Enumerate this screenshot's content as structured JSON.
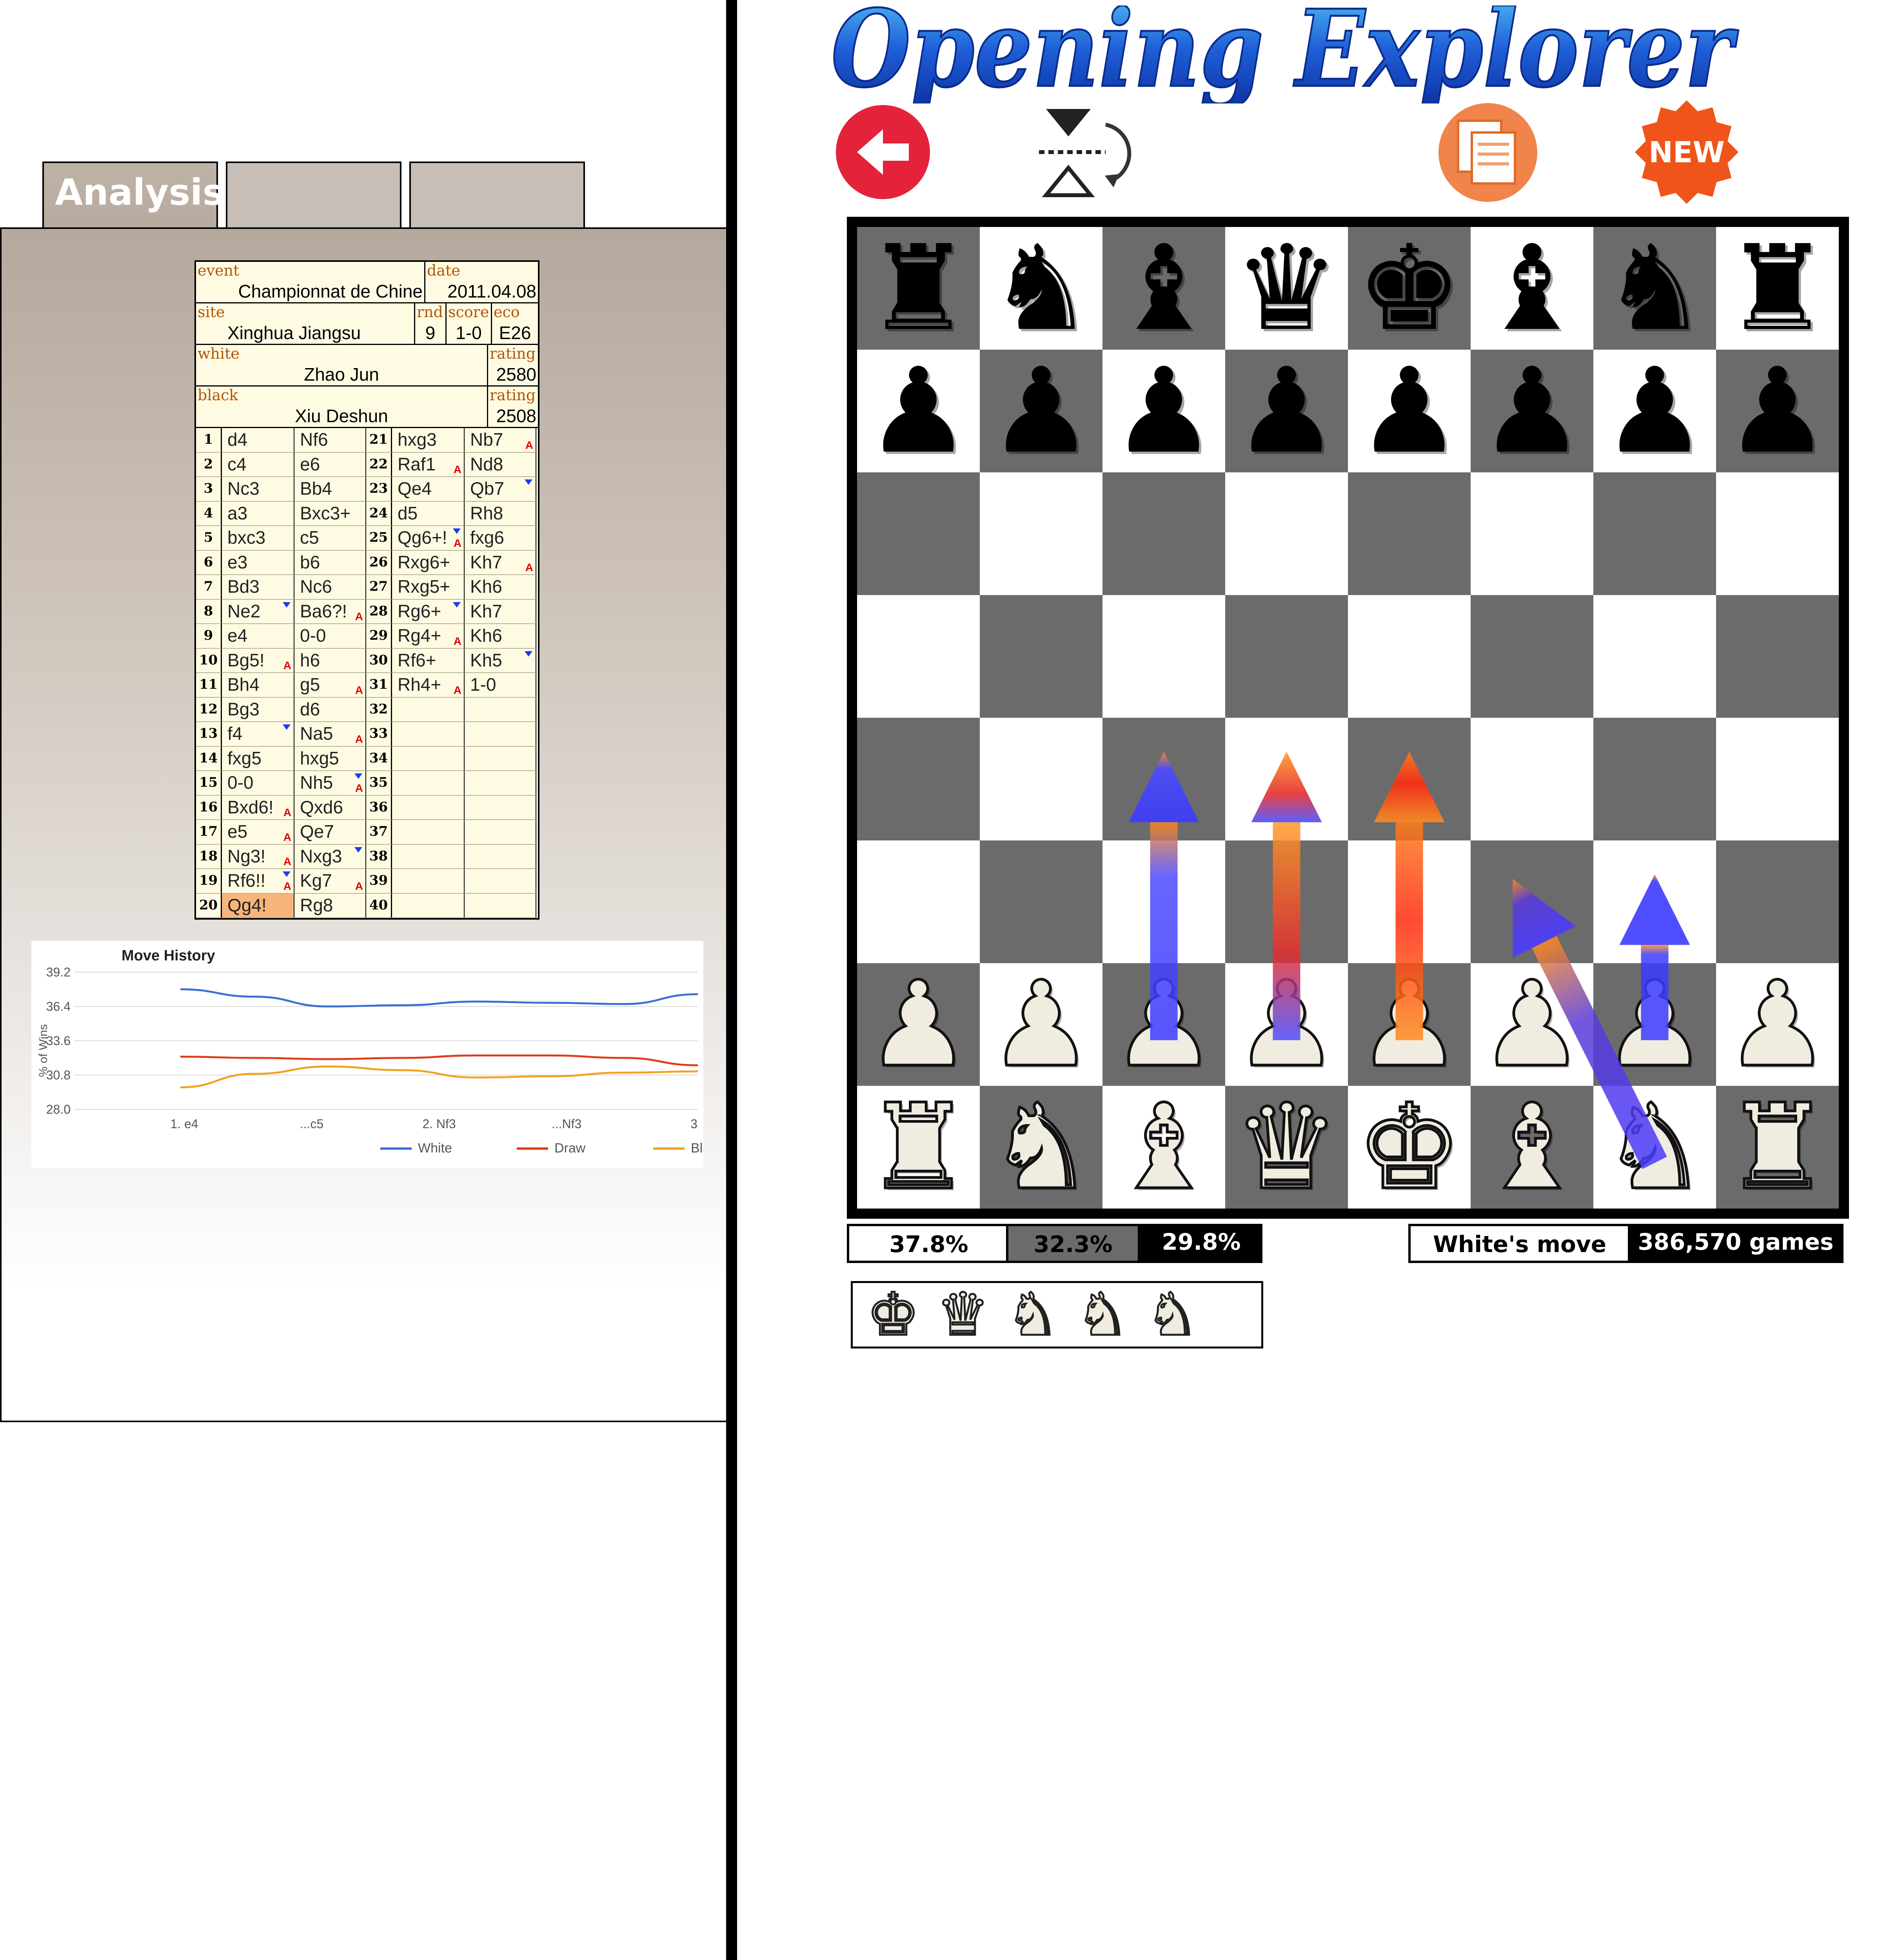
{
  "app": {
    "title": "Opening Explorer"
  },
  "tabs": [
    {
      "label": "Analysis"
    },
    {
      "label": ""
    },
    {
      "label": ""
    }
  ],
  "game_header": {
    "event_label": "event",
    "event": "Championnat de Chine",
    "date_label": "date",
    "date": "2011.04.08",
    "site_label": "site",
    "site": "Xinghua Jiangsu",
    "round_label": "rnd",
    "round": "9",
    "score_label": "score",
    "score": "1-0",
    "eco_label": "eco",
    "eco": "E26",
    "white_label": "white",
    "white": "Zhao Jun",
    "white_rating_label": "rating",
    "white_rating": "2580",
    "black_label": "black",
    "black": "Xiu Deshun",
    "black_rating_label": "rating",
    "black_rating": "2508"
  },
  "moves": [
    {
      "n": "1",
      "w": "d4",
      "b": "Nf6"
    },
    {
      "n": "2",
      "w": "c4",
      "b": "e6"
    },
    {
      "n": "3",
      "w": "Nc3",
      "b": "Bb4"
    },
    {
      "n": "4",
      "w": "a3",
      "b": "Bxc3+"
    },
    {
      "n": "5",
      "w": "bxc3",
      "b": "c5"
    },
    {
      "n": "6",
      "w": "e3",
      "b": "b6"
    },
    {
      "n": "7",
      "w": "Bd3",
      "b": "Nc6"
    },
    {
      "n": "8",
      "w": "Ne2",
      "b": "Ba6?!"
    },
    {
      "n": "9",
      "w": "e4",
      "b": "0-0"
    },
    {
      "n": "10",
      "w": "Bg5!",
      "b": "h6"
    },
    {
      "n": "11",
      "w": "Bh4",
      "b": "g5"
    },
    {
      "n": "12",
      "w": "Bg3",
      "b": "d6"
    },
    {
      "n": "13",
      "w": "f4",
      "b": "Na5"
    },
    {
      "n": "14",
      "w": "fxg5",
      "b": "hxg5"
    },
    {
      "n": "15",
      "w": "0-0",
      "b": "Nh5"
    },
    {
      "n": "16",
      "w": "Bxd6!",
      "b": "Qxd6"
    },
    {
      "n": "17",
      "w": "e5",
      "b": "Qe7"
    },
    {
      "n": "18",
      "w": "Ng3!",
      "b": "Nxg3"
    },
    {
      "n": "19",
      "w": "Rf6!!",
      "b": "Kg7"
    },
    {
      "n": "20",
      "w": "Qg4!",
      "b": "Rg8"
    },
    {
      "n": "21",
      "w": "hxg3",
      "b": "Nb7"
    },
    {
      "n": "22",
      "w": "Raf1",
      "b": "Nd8"
    },
    {
      "n": "23",
      "w": "Qe4",
      "b": "Qb7"
    },
    {
      "n": "24",
      "w": "d5",
      "b": "Rh8"
    },
    {
      "n": "25",
      "w": "Qg6+!",
      "b": "fxg6"
    },
    {
      "n": "26",
      "w": "Rxg6+",
      "b": "Kh7"
    },
    {
      "n": "27",
      "w": "Rxg5+",
      "b": "Kh6"
    },
    {
      "n": "28",
      "w": "Rg6+",
      "b": "Kh7"
    },
    {
      "n": "29",
      "w": "Rg4+",
      "b": "Kh6"
    },
    {
      "n": "30",
      "w": "Rf6+",
      "b": "Kh5"
    },
    {
      "n": "31",
      "w": "Rh4+",
      "b": "1-0"
    },
    {
      "n": "32",
      "w": "",
      "b": ""
    },
    {
      "n": "33",
      "w": "",
      "b": ""
    },
    {
      "n": "34",
      "w": "",
      "b": ""
    },
    {
      "n": "35",
      "w": "",
      "b": ""
    },
    {
      "n": "36",
      "w": "",
      "b": ""
    },
    {
      "n": "37",
      "w": "",
      "b": ""
    },
    {
      "n": "38",
      "w": "",
      "b": ""
    },
    {
      "n": "39",
      "w": "",
      "b": ""
    },
    {
      "n": "40",
      "w": "",
      "b": ""
    }
  ],
  "annotation_marker": "A",
  "chart_data": {
    "type": "line",
    "title": "Move History",
    "ylabel": "% of Wins",
    "xlabel": "",
    "ylim": [
      28.0,
      39.2
    ],
    "yticks": [
      "39.2",
      "36.4",
      "33.6",
      "30.8",
      "28.0"
    ],
    "x": [
      "1. e4",
      "...c5",
      "2. Nf3",
      "...Nf3",
      "3"
    ],
    "series": [
      {
        "name": "White",
        "color": "#3b6fd4",
        "values": [
          37.8,
          37.2,
          36.4,
          36.5,
          36.8,
          36.7,
          36.6,
          37.4
        ]
      },
      {
        "name": "Draw",
        "color": "#e23b1b",
        "values": [
          32.3,
          32.2,
          32.1,
          32.2,
          32.4,
          32.4,
          32.2,
          31.6
        ]
      },
      {
        "name": "Black",
        "color": "#f2a320",
        "values": [
          29.8,
          30.9,
          31.5,
          31.2,
          30.6,
          30.7,
          31.0,
          31.1
        ]
      }
    ],
    "grid": true,
    "legend": "bottom"
  },
  "toolbar": {
    "back_icon": "back-arrow-icon",
    "flip_icon": "flip-board-icon",
    "copy_icon": "copy-icon",
    "new_label": "NEW"
  },
  "board": {
    "ranks": [
      [
        "r",
        "n",
        "b",
        "q",
        "k",
        "b",
        "n",
        "r"
      ],
      [
        "p",
        "p",
        "p",
        "p",
        "p",
        "p",
        "p",
        "p"
      ],
      [
        "",
        "",
        "",
        "",
        "",
        "",
        "",
        ""
      ],
      [
        "",
        "",
        "",
        "",
        "",
        "",
        "",
        ""
      ],
      [
        "",
        "",
        "",
        "",
        "",
        "",
        "",
        ""
      ],
      [
        "",
        "",
        "",
        "",
        "",
        "",
        "",
        ""
      ],
      [
        "P",
        "P",
        "P",
        "P",
        "P",
        "P",
        "P",
        "P"
      ],
      [
        "R",
        "N",
        "B",
        "Q",
        "K",
        "B",
        "N",
        "R"
      ]
    ],
    "suggested_moves": [
      {
        "move": "c2-c4"
      },
      {
        "move": "d2-d4"
      },
      {
        "move": "e2-e4"
      },
      {
        "move": "g1-f3"
      },
      {
        "move": "g2-g3"
      }
    ]
  },
  "stats": {
    "white_pct": "37.8%",
    "draw_pct": "32.3%",
    "black_pct": "29.8%",
    "white_frac": 0.378,
    "draw_frac": 0.323,
    "black_frac": 0.298,
    "to_move": "White's move",
    "games": "386,570 games"
  },
  "captured": [
    "K",
    "Q",
    "N",
    "N",
    "N"
  ]
}
